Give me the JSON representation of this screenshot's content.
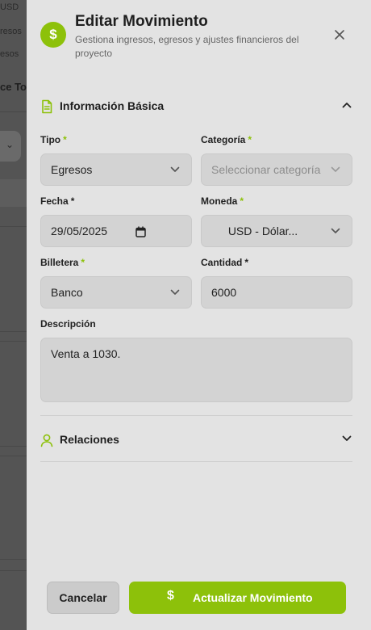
{
  "background": {
    "texts": [
      "USD",
      "resos",
      "esos",
      "ce Tot"
    ]
  },
  "header": {
    "icon": "dollar-icon",
    "title": "Editar Movimiento",
    "subtitle": "Gestiona ingresos, egresos y ajustes financieros del proyecto",
    "close_icon": "close-icon"
  },
  "section_basic": {
    "title": "Información Básica",
    "icon": "document-icon",
    "state_icon": "chevron-up-icon"
  },
  "fields": {
    "tipo": {
      "label": "Tipo",
      "value": "Egresos"
    },
    "categoria": {
      "label": "Categoría",
      "placeholder": "Seleccionar categoría"
    },
    "fecha": {
      "label": "Fecha",
      "value": "29/05/2025"
    },
    "moneda": {
      "label": "Moneda",
      "value": "USD - Dólar..."
    },
    "billetera": {
      "label": "Billetera",
      "value": "Banco"
    },
    "cantidad": {
      "label": "Cantidad",
      "value": "6000"
    },
    "descripcion": {
      "label": "Descripción",
      "value": "Venta a 1030."
    }
  },
  "required_mark": "*",
  "section_relations": {
    "title": "Relaciones",
    "icon": "user-icon",
    "state_icon": "chevron-down-icon"
  },
  "footer": {
    "cancel_label": "Cancelar",
    "submit_label": "Actualizar Movimiento",
    "submit_icon": "dollar-icon"
  },
  "colors": {
    "accent": "#8dc10a",
    "drawer_bg": "#e3e3e3",
    "field_bg": "#d3d3d3"
  }
}
